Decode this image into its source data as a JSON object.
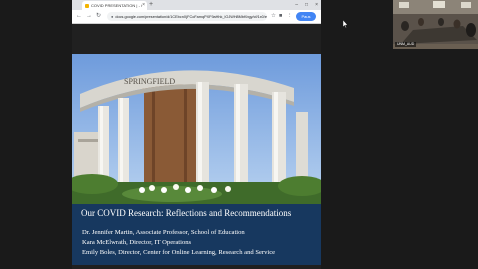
{
  "browser": {
    "tab_title": "COVID PRESENTATION | - Goo",
    "tab_close": "×",
    "new_tab": "+",
    "window_controls": [
      "–",
      "□",
      "×"
    ],
    "url": "docs.google.com/presentation/d/1CEbcnXjFCoFamqPXF9aHhk_lOJWH8MbKbgy/cf/1x0/edit...",
    "nav": {
      "back": "←",
      "forward": "→",
      "reload": "↻"
    },
    "profile": "Paus"
  },
  "slide": {
    "sign_text": "SPRINGFIELD",
    "title": "Our COVID Research: Reflections and Recommendations",
    "presenters": [
      "Dr. Jennifer Martin, Associate Professor, School of Education",
      "Kara McElwrath, Director, IT Operations",
      "Emily Boles, Director, Center for Online Learning, Research and Service"
    ]
  },
  "video": {
    "participant_label": "UNM_AUD"
  },
  "colors": {
    "band": "#17385f",
    "page_bg": "#1a1a1a",
    "profile": "#4285f4"
  },
  "icons": [
    "back-icon",
    "forward-icon",
    "reload-icon",
    "lock-icon",
    "star-icon",
    "extension-icon",
    "menu-icon",
    "cursor-icon"
  ]
}
